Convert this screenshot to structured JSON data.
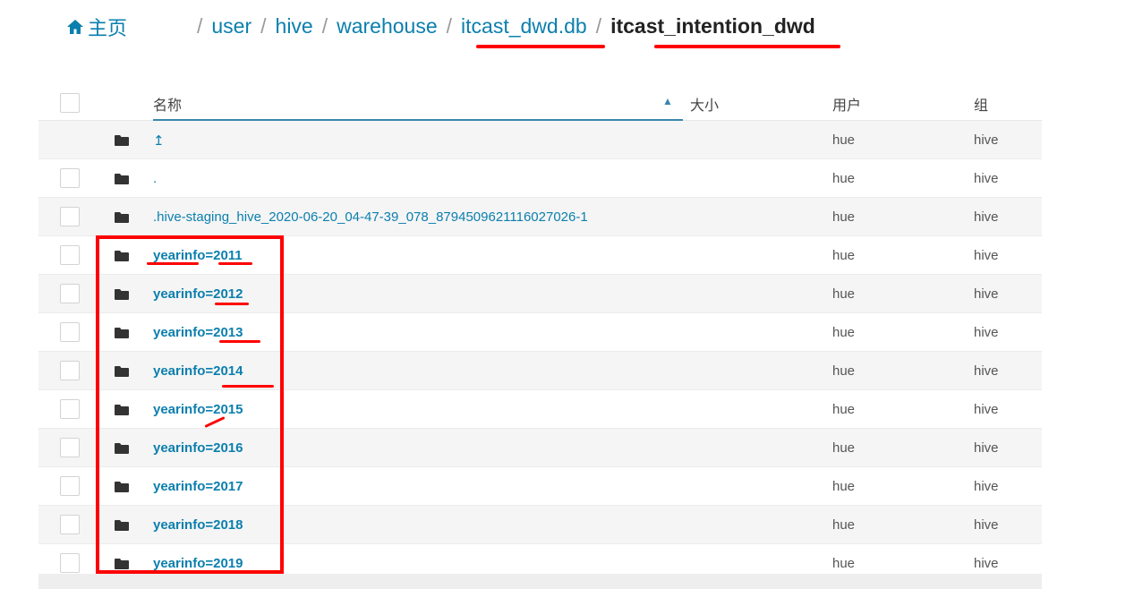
{
  "breadcrumb": {
    "home_label": "主页",
    "separator": "/",
    "links": [
      "user",
      "hive",
      "warehouse",
      "itcast_dwd.db"
    ],
    "current": "itcast_intention_dwd"
  },
  "table": {
    "columns": {
      "name": "名称",
      "size": "大小",
      "user": "用户",
      "group": "组"
    },
    "sort": {
      "column": "name",
      "direction": "ascending"
    },
    "rows": [
      {
        "name": "↥",
        "user": "hue",
        "group": "hive"
      },
      {
        "name": ".",
        "user": "hue",
        "group": "hive"
      },
      {
        "name": ".hive-staging_hive_2020-06-20_04-47-39_078_8794509621116027026-1",
        "user": "hue",
        "group": "hive"
      },
      {
        "name": "yearinfo=2011",
        "user": "hue",
        "group": "hive"
      },
      {
        "name": "yearinfo=2012",
        "user": "hue",
        "group": "hive"
      },
      {
        "name": "yearinfo=2013",
        "user": "hue",
        "group": "hive"
      },
      {
        "name": "yearinfo=2014",
        "user": "hue",
        "group": "hive"
      },
      {
        "name": "yearinfo=2015",
        "user": "hue",
        "group": "hive"
      },
      {
        "name": "yearinfo=2016",
        "user": "hue",
        "group": "hive"
      },
      {
        "name": "yearinfo=2017",
        "user": "hue",
        "group": "hive"
      },
      {
        "name": "yearinfo=2018",
        "user": "hue",
        "group": "hive"
      },
      {
        "name": "yearinfo=2019",
        "user": "hue",
        "group": "hive"
      }
    ]
  },
  "colors": {
    "link": "#0B7FAD",
    "annotation": "#FF0000",
    "row_alt": "#F5F5F5"
  },
  "icons": {
    "home": "home-icon",
    "folder": "folder-icon",
    "sort": "sort-ascending-icon"
  }
}
